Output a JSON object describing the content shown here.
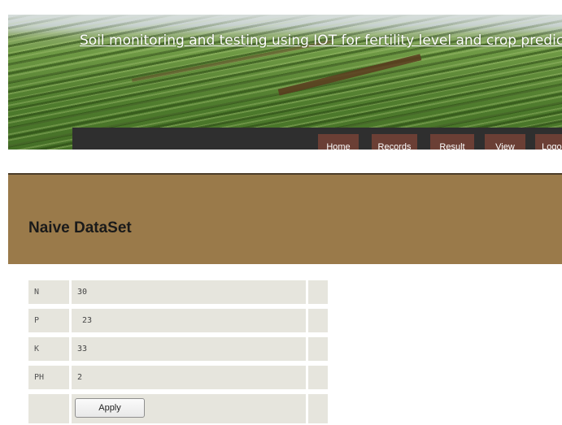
{
  "header": {
    "title": "Soil monitoring and testing using IOT for fertility level and crop prediction"
  },
  "nav": {
    "items": [
      {
        "label": "Home"
      },
      {
        "label": "Records"
      },
      {
        "label": "Result"
      },
      {
        "label": "View"
      },
      {
        "label": "Logout"
      }
    ]
  },
  "section": {
    "title": "Naive DataSet"
  },
  "form": {
    "rows": [
      {
        "label": "N",
        "value": "30"
      },
      {
        "label": "P",
        "value": " 23"
      },
      {
        "label": "K",
        "value": "33"
      },
      {
        "label": "PH",
        "value": "2"
      }
    ],
    "apply_label": "Apply"
  },
  "colors": {
    "nav_bg": "#2f2f2f",
    "nav_item": "#6b3f35",
    "section_bar": "#9a7a4a",
    "form_cell": "#e6e5dd"
  }
}
